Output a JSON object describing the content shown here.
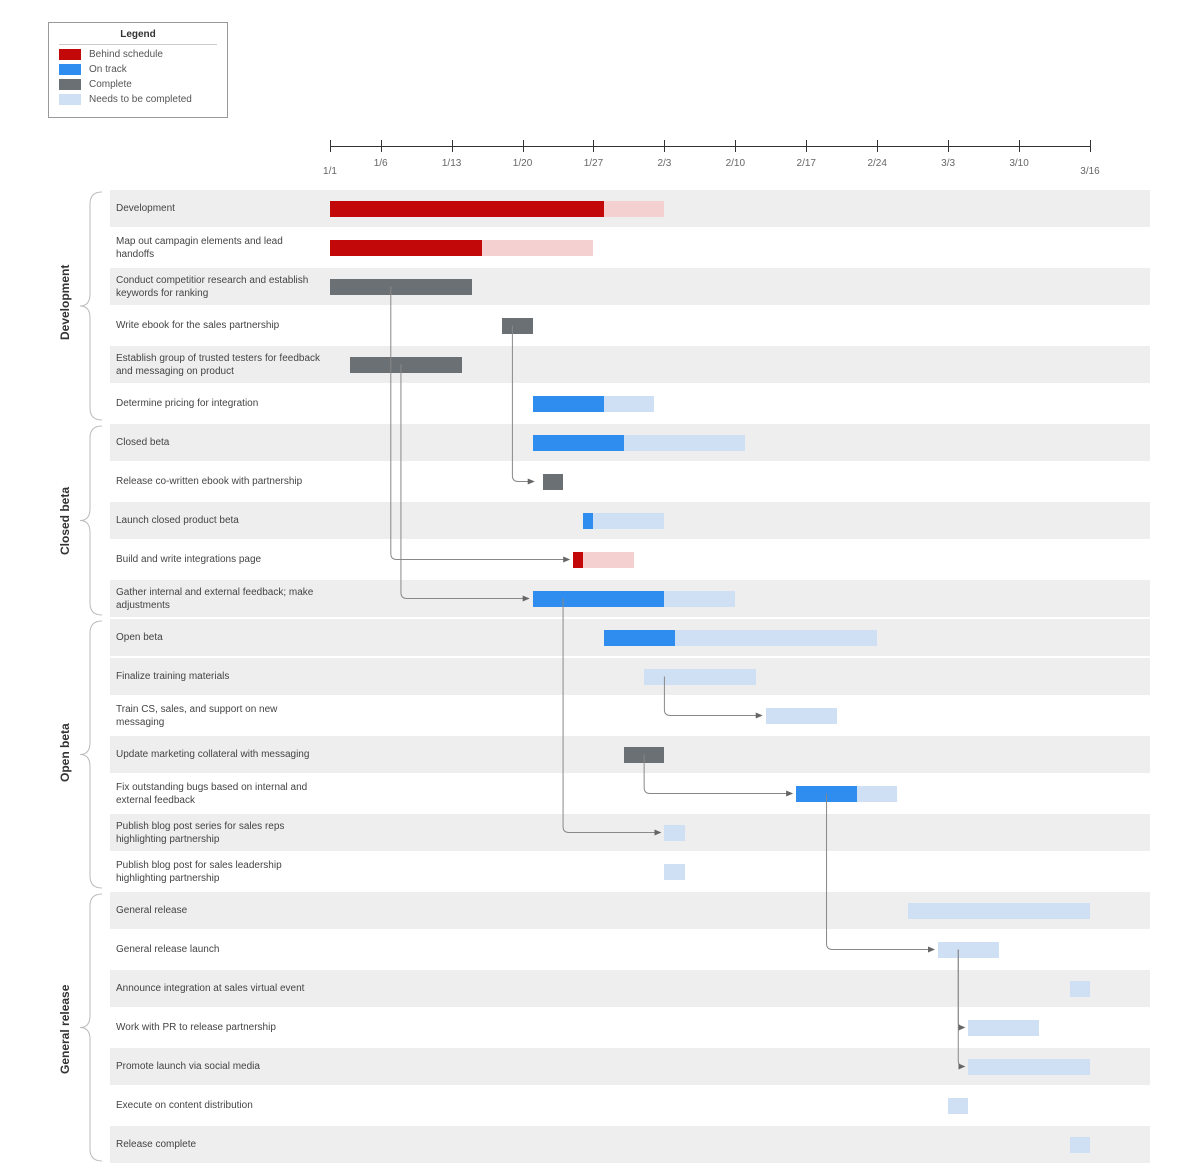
{
  "legend": {
    "title": "Legend",
    "items": [
      {
        "label": "Behind schedule",
        "class": "sw-behind"
      },
      {
        "label": "On track",
        "class": "sw-ontrack"
      },
      {
        "label": "Complete",
        "class": "sw-complete"
      },
      {
        "label": "Needs to be completed",
        "class": "sw-needs"
      }
    ]
  },
  "axis": {
    "start": "1/1",
    "end": "3/16",
    "ticks": [
      "1/6",
      "1/13",
      "1/20",
      "1/27",
      "2/3",
      "2/10",
      "2/17",
      "2/24",
      "3/3",
      "3/10"
    ]
  },
  "groups": [
    {
      "name": "Development",
      "startRow": 0,
      "endRow": 5
    },
    {
      "name": "Closed beta",
      "startRow": 6,
      "endRow": 10
    },
    {
      "name": "Open beta",
      "startRow": 11,
      "endRow": 17
    },
    {
      "name": "General release",
      "startRow": 18,
      "endRow": 24
    }
  ],
  "chart_data": {
    "type": "bar",
    "xlabel": "",
    "ylabel": "",
    "xrange_days": [
      0,
      75
    ],
    "categories": [
      "Development",
      "Map out campagin elements and lead handoffs",
      "Conduct competitior research and establish keywords for ranking",
      "Write ebook for the sales partnership",
      "Establish group of trusted testers for feedback and messaging on product",
      "Determine pricing for integration",
      "Closed beta",
      "Release co-written ebook with partnership",
      "Launch closed product beta",
      "Build and write integrations page",
      "Gather internal and external feedback; make adjustments",
      "Open beta",
      "Finalize training materials",
      "Train CS, sales, and support on new messaging",
      "Update marketing collateral with messaging",
      "Fix outstanding bugs based on internal and external feedback",
      "Publish blog post series for sales reps highlighting partnership",
      "Publish blog post for sales leadership highlighting partnership",
      "General release",
      "General release launch",
      "Announce integration at sales virtual event",
      "Work with PR to release partnership",
      "Promote launch via social media",
      "Execute on content distribution",
      "Release complete"
    ],
    "rows": [
      {
        "shaded": true,
        "bars": [
          {
            "start": 0,
            "end": 27,
            "style": "behind-solid"
          },
          {
            "start": 27,
            "end": 33,
            "style": "behind-light"
          }
        ]
      },
      {
        "shaded": false,
        "bars": [
          {
            "start": 0,
            "end": 15,
            "style": "behind-solid"
          },
          {
            "start": 15,
            "end": 26,
            "style": "behind-light"
          }
        ]
      },
      {
        "shaded": true,
        "bars": [
          {
            "start": 0,
            "end": 14,
            "style": "complete"
          }
        ]
      },
      {
        "shaded": false,
        "bars": [
          {
            "start": 17,
            "end": 20,
            "style": "complete"
          }
        ]
      },
      {
        "shaded": true,
        "bars": [
          {
            "start": 2,
            "end": 13,
            "style": "complete"
          }
        ]
      },
      {
        "shaded": false,
        "bars": [
          {
            "start": 20,
            "end": 27,
            "style": "blue-solid"
          },
          {
            "start": 27,
            "end": 32,
            "style": "blue-light"
          }
        ]
      },
      {
        "shaded": true,
        "bars": [
          {
            "start": 20,
            "end": 29,
            "style": "blue-solid"
          },
          {
            "start": 29,
            "end": 41,
            "style": "blue-light"
          }
        ]
      },
      {
        "shaded": false,
        "bars": [
          {
            "start": 21,
            "end": 23,
            "style": "complete"
          }
        ]
      },
      {
        "shaded": true,
        "bars": [
          {
            "start": 25,
            "end": 26,
            "style": "blue-solid"
          },
          {
            "start": 26,
            "end": 33,
            "style": "blue-light"
          }
        ]
      },
      {
        "shaded": false,
        "bars": [
          {
            "start": 24,
            "end": 25,
            "style": "behind-solid"
          },
          {
            "start": 25,
            "end": 30,
            "style": "behind-light"
          }
        ]
      },
      {
        "shaded": true,
        "bars": [
          {
            "start": 20,
            "end": 33,
            "style": "blue-solid"
          },
          {
            "start": 33,
            "end": 40,
            "style": "blue-light"
          }
        ]
      },
      {
        "shaded": true,
        "bars": [
          {
            "start": 27,
            "end": 34,
            "style": "blue-solid"
          },
          {
            "start": 34,
            "end": 54,
            "style": "blue-light"
          }
        ]
      },
      {
        "shaded": true,
        "bars": [
          {
            "start": 31,
            "end": 42,
            "style": "blue-light"
          }
        ]
      },
      {
        "shaded": false,
        "bars": [
          {
            "start": 43,
            "end": 50,
            "style": "blue-light"
          }
        ]
      },
      {
        "shaded": true,
        "bars": [
          {
            "start": 29,
            "end": 33,
            "style": "complete"
          }
        ]
      },
      {
        "shaded": false,
        "bars": [
          {
            "start": 46,
            "end": 52,
            "style": "blue-solid"
          },
          {
            "start": 52,
            "end": 56,
            "style": "blue-light"
          }
        ]
      },
      {
        "shaded": true,
        "bars": [
          {
            "start": 33,
            "end": 35,
            "style": "blue-light"
          }
        ]
      },
      {
        "shaded": false,
        "bars": [
          {
            "start": 33,
            "end": 35,
            "style": "blue-light"
          }
        ]
      },
      {
        "shaded": true,
        "bars": [
          {
            "start": 57,
            "end": 75,
            "style": "blue-light"
          }
        ]
      },
      {
        "shaded": false,
        "bars": [
          {
            "start": 60,
            "end": 66,
            "style": "blue-light"
          }
        ]
      },
      {
        "shaded": true,
        "bars": [
          {
            "start": 73,
            "end": 75,
            "style": "blue-light"
          }
        ]
      },
      {
        "shaded": false,
        "bars": [
          {
            "start": 63,
            "end": 70,
            "style": "blue-light"
          }
        ]
      },
      {
        "shaded": true,
        "bars": [
          {
            "start": 63,
            "end": 75,
            "style": "blue-light"
          }
        ]
      },
      {
        "shaded": false,
        "bars": [
          {
            "start": 61,
            "end": 63,
            "style": "blue-light"
          }
        ]
      },
      {
        "shaded": true,
        "bars": [
          {
            "start": 73,
            "end": 75,
            "style": "blue-light"
          }
        ]
      }
    ]
  },
  "connectors": [
    {
      "fromRow": 2,
      "xOut": 6,
      "toRow": 9,
      "xIn": 24
    },
    {
      "fromRow": 3,
      "xOut": 18,
      "toRow": 7,
      "xIn": 20.5
    },
    {
      "fromRow": 4,
      "xOut": 7,
      "toRow": 10,
      "xIn": 20
    },
    {
      "fromRow": 10,
      "xOut": 23,
      "toRow": 16,
      "xIn": 33
    },
    {
      "fromRow": 12,
      "xOut": 33,
      "toRow": 13,
      "xIn": 43
    },
    {
      "fromRow": 14,
      "xOut": 31,
      "toRow": 15,
      "xIn": 46
    },
    {
      "fromRow": 15,
      "xOut": 49,
      "toRow": 19,
      "xIn": 60
    },
    {
      "fromRow": 19,
      "xOut": 62,
      "toRow": 21,
      "xIn": 63
    },
    {
      "fromRow": 19,
      "xOut": 62,
      "toRow": 22,
      "xIn": 63
    }
  ]
}
